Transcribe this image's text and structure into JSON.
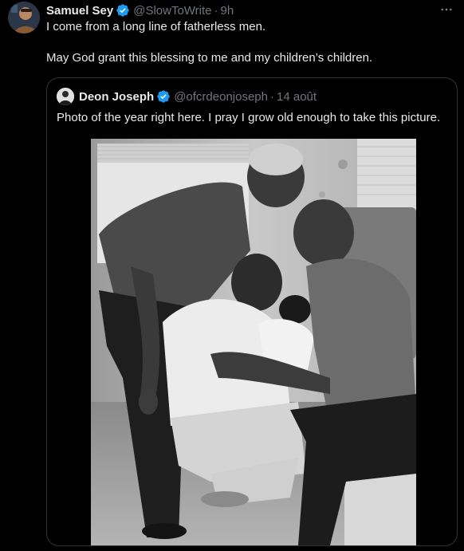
{
  "tweet": {
    "author_name": "Samuel Sey",
    "handle": "@SlowToWrite",
    "separator": "·",
    "time": "9h",
    "more_icon": "more-horizontal-icon",
    "text_line1": "I come from a long line of fatherless men.",
    "text_line2": "May God grant this blessing to me and my children’s children."
  },
  "quote": {
    "author_name": "Deon Joseph",
    "handle": "@ofcrdeonjoseph",
    "separator": "·",
    "date": "14 août",
    "text": "Photo of the year right here. I pray I grow old enough to take this picture."
  },
  "colors": {
    "background": "#000000",
    "text_primary": "#e7e9ea",
    "text_secondary": "#71767b",
    "verified_badge": "#1d9bf0",
    "border": "#2f3336"
  }
}
